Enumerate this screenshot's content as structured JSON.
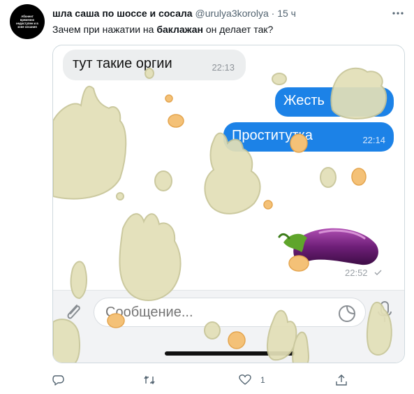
{
  "tweet": {
    "avatar_text": "Абонент временно недоступен и в зоне сосания",
    "author_name": "шла саша по шоссе и сосала",
    "handle": "@urulya3korolya",
    "separator": "·",
    "time": "15 ч",
    "text_before": "Зачем при нажатии на ",
    "text_bold": "баклажан",
    "text_after": " он делает так?"
  },
  "chat": {
    "incoming": {
      "text": "тут такие оргии",
      "time": "22:13"
    },
    "outgoing": [
      {
        "text": "Жесть"
      },
      {
        "text": "Проститутка",
        "time": "22:14"
      }
    ],
    "eggplant_time": "22:52",
    "input_placeholder": "Сообщение...",
    "colors": {
      "outgoing_bubble": "#1c82e7",
      "incoming_bubble": "#eceeef",
      "splash": "#e2dfb7",
      "drop": "#f4c177"
    }
  },
  "actions": {
    "reply_icon": "reply-icon",
    "retweet_icon": "retweet-icon",
    "like_icon": "heart-icon",
    "like_count": "1",
    "share_icon": "share-icon"
  }
}
